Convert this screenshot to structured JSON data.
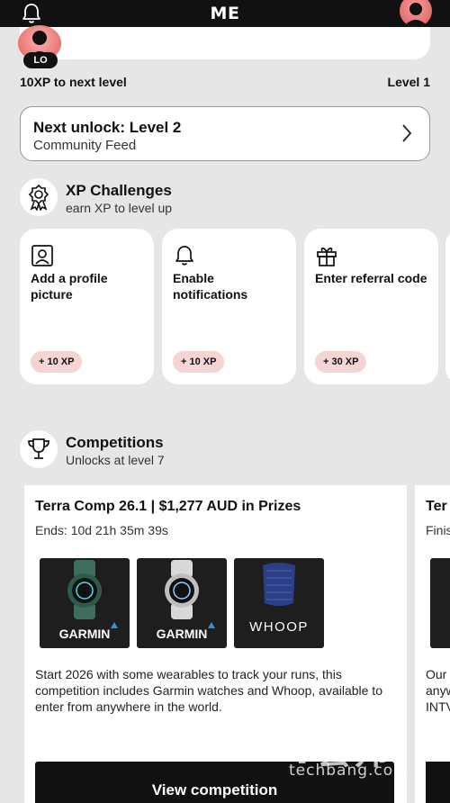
{
  "header": {
    "title": "ME",
    "bell_icon": "bell-icon",
    "profile_icon": "avatar-icon"
  },
  "level_progress": {
    "badge": "LO",
    "xp_to_next": "10XP to next level",
    "current_level": "Level 1"
  },
  "next_unlock": {
    "title": "Next unlock: Level 2",
    "subtitle": "Community Feed"
  },
  "xp_challenges": {
    "title": "XP Challenges",
    "subtitle": "earn XP to level up",
    "items": [
      {
        "icon": "profile-picture-icon",
        "label": "Add a profile picture",
        "reward": "+ 10 XP"
      },
      {
        "icon": "bell-icon",
        "label": "Enable notifications",
        "reward": "+ 10 XP"
      },
      {
        "icon": "gift-icon",
        "label": "Enter referral code",
        "reward": "+ 30 XP"
      }
    ]
  },
  "competitions": {
    "title": "Competitions",
    "subtitle": "Unlocks at level 7",
    "cards": [
      {
        "title": "Terra Comp 26.1 | $1,277 AUD in Prizes",
        "ends": "Ends: 10d 21h 35m 39s",
        "products": [
          "GARMIN",
          "GARMIN",
          "WHOOP"
        ],
        "description": "Start 2026 with some wearables to track your runs, this competition includes Garmin watches and Whoop, available to enter from anywhere in the world.",
        "button": "View competition"
      },
      {
        "title": "Ter",
        "ends": "Finis",
        "description": "Our\nanyw\nINTV"
      }
    ]
  },
  "watermark": {
    "logo": "T套邦",
    "domain": "techbang.com"
  },
  "colors": {
    "accent_pink": "#f6d4d4",
    "avatar_red": "#e05555",
    "dark": "#111111"
  }
}
